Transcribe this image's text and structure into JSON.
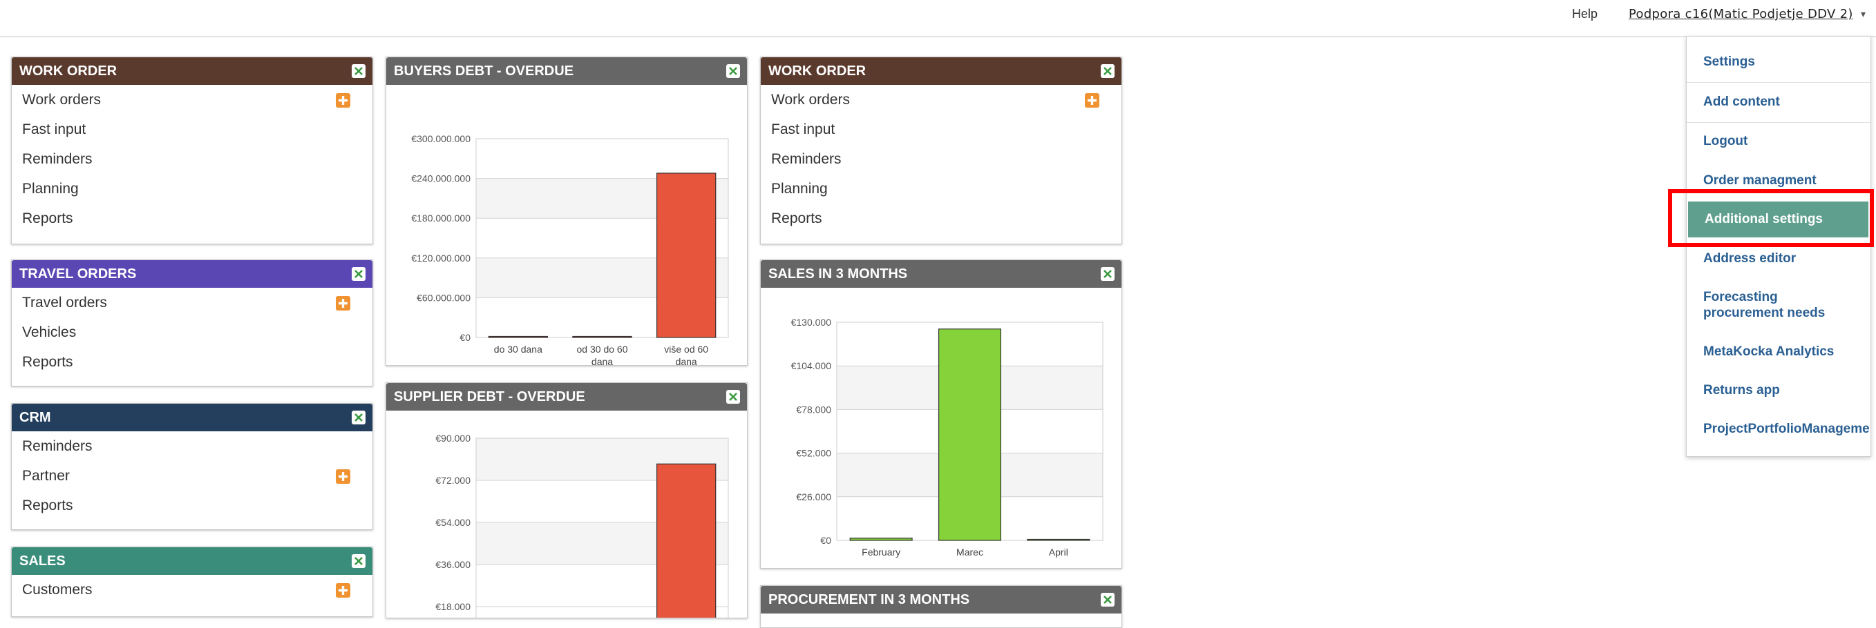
{
  "topbar": {
    "help_label": "Help",
    "user_label": "Podpora c16(Matic Podjetje DDV 2)",
    "caret": "▾"
  },
  "widgets": {
    "work_order_1": {
      "title": "WORK ORDER",
      "color": "#5b3a2e",
      "items": [
        {
          "label": "Work orders",
          "add": true
        },
        {
          "label": "Fast input",
          "add": false
        },
        {
          "label": "Reminders",
          "add": false
        },
        {
          "label": "Planning",
          "add": false
        },
        {
          "label": "Reports",
          "add": false
        }
      ]
    },
    "travel_orders": {
      "title": "TRAVEL ORDERS",
      "color": "#5a47b4",
      "items": [
        {
          "label": "Travel orders",
          "add": true
        },
        {
          "label": "Vehicles",
          "add": false
        },
        {
          "label": "Reports",
          "add": false
        }
      ]
    },
    "crm": {
      "title": "CRM",
      "color": "#243f5e",
      "items": [
        {
          "label": "Reminders",
          "add": false
        },
        {
          "label": "Partner",
          "add": true
        },
        {
          "label": "Reports",
          "add": false
        }
      ]
    },
    "sales": {
      "title": "SALES",
      "color": "#3a8d7b",
      "items": [
        {
          "label": "Customers",
          "add": true
        }
      ]
    },
    "buyers_debt": {
      "title": "BUYERS DEBT - OVERDUE",
      "color": "#666666"
    },
    "supplier_debt": {
      "title": "SUPPLIER DEBT - OVERDUE",
      "color": "#666666"
    },
    "work_order_2": {
      "title": "WORK ORDER",
      "color": "#5b3a2e",
      "items": [
        {
          "label": "Work orders",
          "add": true
        },
        {
          "label": "Fast input",
          "add": false
        },
        {
          "label": "Reminders",
          "add": false
        },
        {
          "label": "Planning",
          "add": false
        },
        {
          "label": "Reports",
          "add": false
        }
      ]
    },
    "sales_3m": {
      "title": "SALES IN 3 MONTHS",
      "color": "#666666"
    },
    "procurement_3m": {
      "title": "PROCUREMENT IN 3 MONTHS",
      "color": "#666666"
    }
  },
  "chart_data": [
    {
      "type": "bar",
      "title": "BUYERS DEBT - OVERDUE",
      "categories": [
        "do 30 dana",
        "od 30 do 60 dana",
        "više od 60 dana"
      ],
      "values": [
        500000,
        500000,
        248000000
      ],
      "yticks": [
        "€0",
        "€60.000.000",
        "€120.000.000",
        "€180.000.000",
        "€240.000.000",
        "€300.000.000"
      ],
      "ylim": [
        0,
        300000000
      ],
      "bar_colors": [
        "#e8553d",
        "#e8553d",
        "#e8553d"
      ],
      "grid": true
    },
    {
      "type": "bar",
      "title": "SUPPLIER DEBT - OVERDUE",
      "categories": [
        "",
        "",
        ""
      ],
      "values": [
        0,
        0,
        79000
      ],
      "yticks": [
        "€18.000",
        "€36.000",
        "€54.000",
        "€72.000",
        "€90.000"
      ],
      "ylim": [
        0,
        90000
      ],
      "bar_colors": [
        "#e8553d",
        "#e8553d",
        "#e8553d"
      ],
      "grid": true
    },
    {
      "type": "bar",
      "title": "SALES IN 3 MONTHS",
      "categories": [
        "February",
        "Marec",
        "April"
      ],
      "values": [
        1300,
        126000,
        600
      ],
      "yticks": [
        "€0",
        "€26.000",
        "€52.000",
        "€78.000",
        "€104.000",
        "€130.000"
      ],
      "ylim": [
        0,
        130000
      ],
      "bar_colors": [
        "#86d23a",
        "#86d23a",
        "#86d23a"
      ],
      "grid": true
    }
  ],
  "menu": {
    "items": [
      {
        "label": "Settings",
        "active": false
      },
      {
        "label": "Add content",
        "active": false
      },
      {
        "label": "Logout",
        "active": false
      },
      {
        "label": "Order managment",
        "active": false
      },
      {
        "label": "Additional settings",
        "active": true
      },
      {
        "label": "Address editor",
        "active": false
      },
      {
        "label": "Forecasting procurement needs",
        "active": false
      },
      {
        "label": "MetaKocka Analytics",
        "active": false
      },
      {
        "label": "Returns app",
        "active": false
      },
      {
        "label": "ProjectPortfolioManageme",
        "active": false
      }
    ],
    "highlight_color": "#ff0000",
    "active_color": "#5e9f8e"
  }
}
